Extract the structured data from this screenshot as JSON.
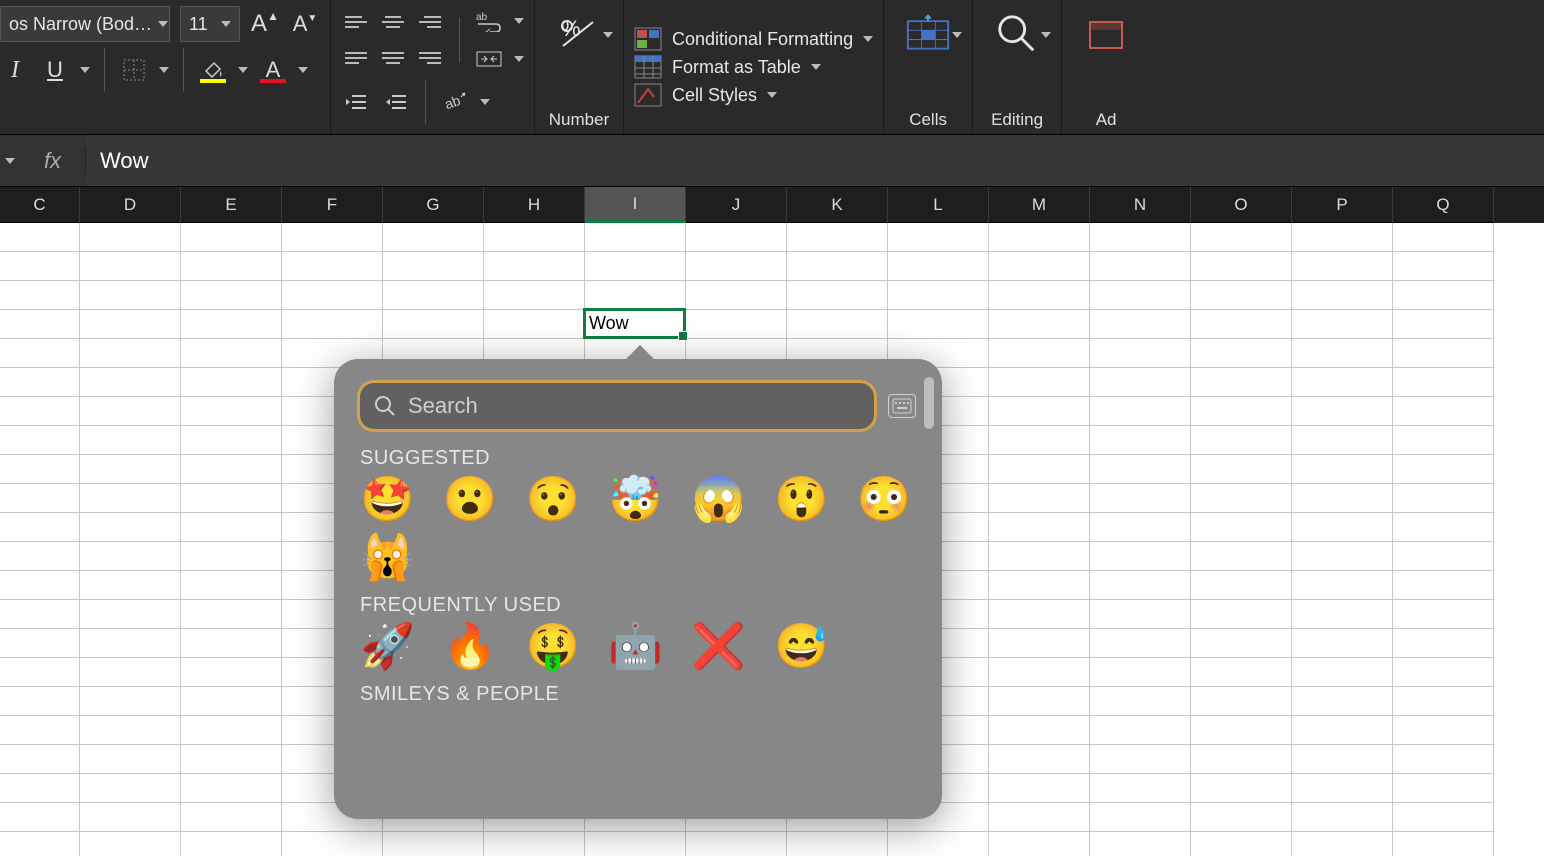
{
  "ribbon": {
    "font_name": "os Narrow (Bod…",
    "font_size": "11",
    "number_group_label": "Number",
    "cells_group_label": "Cells",
    "editing_group_label": "Editing",
    "addins_group_label": "Ad",
    "conditional_formatting": "Conditional Formatting",
    "format_as_table": "Format as Table",
    "cell_styles": "Cell Styles"
  },
  "formula_bar": {
    "fx": "fx",
    "value": "Wow"
  },
  "columns": [
    "C",
    "D",
    "E",
    "F",
    "G",
    "H",
    "I",
    "J",
    "K",
    "L",
    "M",
    "N",
    "O",
    "P",
    "Q"
  ],
  "active_column": "I",
  "active_cell_value": "Wow",
  "emoji_picker": {
    "search_placeholder": "Search",
    "section_suggested": "SUGGESTED",
    "section_frequent": "FREQUENTLY USED",
    "section_smileys": "SMILEYS & PEOPLE",
    "suggested": [
      "🤩",
      "😮",
      "😯",
      "🤯",
      "😱",
      "😲",
      "😳",
      "🙀"
    ],
    "frequent": [
      "🚀",
      "🔥",
      "🤑",
      "🤖",
      "❌",
      "😅"
    ]
  }
}
